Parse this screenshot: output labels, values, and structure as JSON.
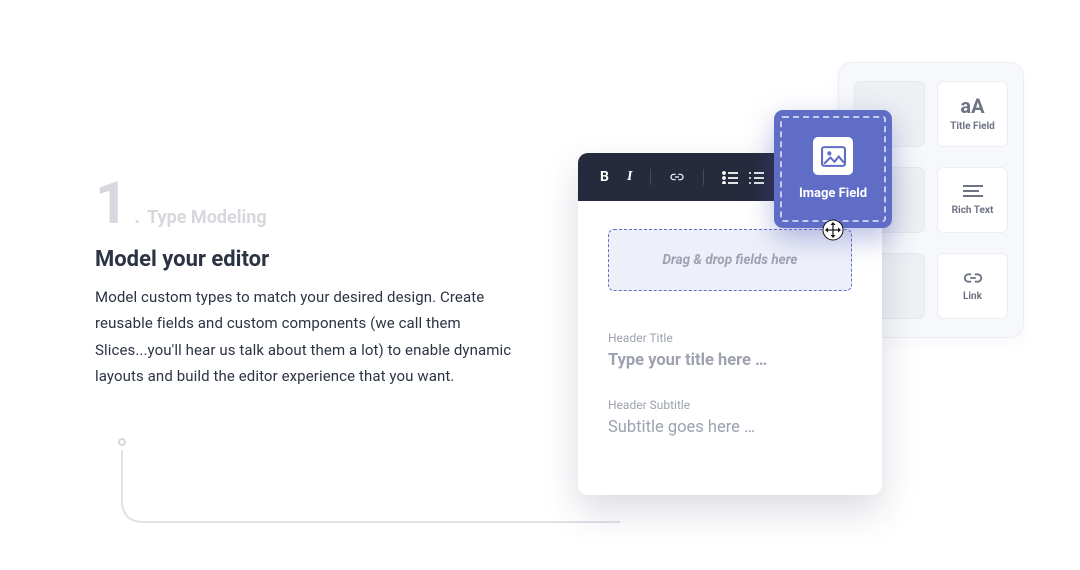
{
  "step": {
    "number": "1",
    "label": "Type Modeling"
  },
  "heading": "Model your editor",
  "body": "Model custom types to match your desired design. Create reusable fields and custom components (we call them Slices...you'll hear us talk about them a lot) to enable dynamic layouts and build the editor experience that you want.",
  "palette": {
    "title_field": {
      "icon": "aA",
      "label": "Title Field"
    },
    "rich_text": {
      "label": "Rich Text"
    },
    "link": {
      "label": "Link"
    }
  },
  "drag": {
    "label": "Image Field"
  },
  "editor": {
    "dropzone": "Drag & drop fields here",
    "title_caption": "Header Title",
    "title_placeholder": "Type your title here …",
    "subtitle_caption": "Header Subtitle",
    "subtitle_placeholder": "Subtitle goes here …"
  }
}
